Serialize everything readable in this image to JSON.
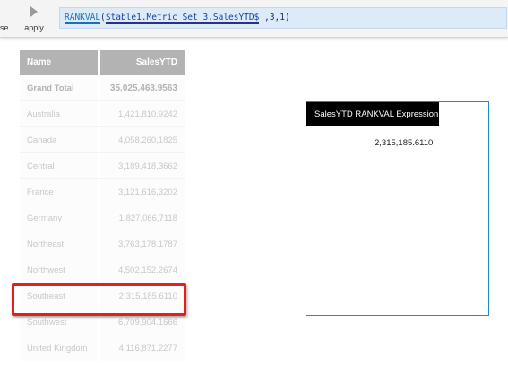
{
  "toolbar": {
    "close_label": "close",
    "apply_label": "apply",
    "formula": {
      "func": "RANKVAL",
      "open_paren": "(",
      "ref": "$table1.Metric Set 3.SalesYTD$",
      "args": " ,3,1)"
    }
  },
  "table": {
    "headers": {
      "name": "Name",
      "value": "SalesYTD"
    },
    "total": {
      "name": "Grand Total",
      "value": "35,025,463.9563"
    },
    "rows": [
      {
        "name": "Australia",
        "value": "1,421,810.9242"
      },
      {
        "name": "Canada",
        "value": "4,058,260,1825"
      },
      {
        "name": "Central",
        "value": "3,189,418,3662"
      },
      {
        "name": "France",
        "value": "3,121,616,3202"
      },
      {
        "name": "Germany",
        "value": "1,827,066,7118"
      },
      {
        "name": "Northeast",
        "value": "3,763,178.1787"
      },
      {
        "name": "Northwest",
        "value": "4,502,152.2674"
      },
      {
        "name": "Southeast",
        "value": "2,315,185.6110"
      },
      {
        "name": "Southwest",
        "value": "6,709,904.1666"
      },
      {
        "name": "United Kingdom",
        "value": "4,116,871.2277"
      }
    ]
  },
  "visual": {
    "title": "SalesYTD RANKVAL Expression",
    "value": "2,315,185.6110"
  },
  "colors": {
    "highlight": "#e0201c",
    "header_bg": "#b3b3b3",
    "formula_bg": "#dcebf7",
    "visual_border": "#1e8cc6"
  }
}
